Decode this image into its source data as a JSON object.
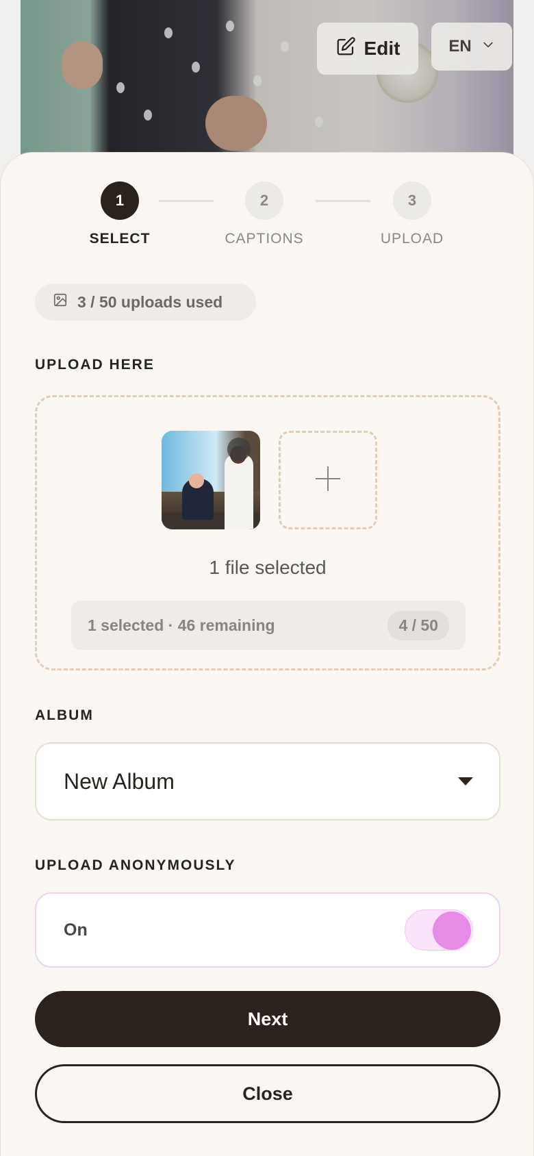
{
  "header": {
    "edit_label": "Edit",
    "language": "EN"
  },
  "stepper": {
    "steps": [
      {
        "number": "1",
        "label": "SELECT",
        "state": "active"
      },
      {
        "number": "2",
        "label": "CAPTIONS",
        "state": "pending"
      },
      {
        "number": "3",
        "label": "UPLOAD",
        "state": "pending"
      }
    ]
  },
  "usage": {
    "text": "3 / 50 uploads used",
    "icon": "image-icon"
  },
  "upload": {
    "section_label": "UPLOAD HERE",
    "files_selected_text": "1 file selected",
    "remaining_text": "1 selected · 46 remaining",
    "count_badge": "4 / 50",
    "add_icon": "plus-icon"
  },
  "album": {
    "section_label": "ALBUM",
    "selected_value": "New Album"
  },
  "anonymous": {
    "section_label": "UPLOAD ANONYMOUSLY",
    "state_label": "On",
    "enabled": true
  },
  "actions": {
    "next_label": "Next",
    "close_label": "Close"
  },
  "colors": {
    "primary": "#2b211d",
    "background": "#faf7f2",
    "accent_toggle": "#e58be6",
    "dashed_border": "#e2cdb4"
  }
}
